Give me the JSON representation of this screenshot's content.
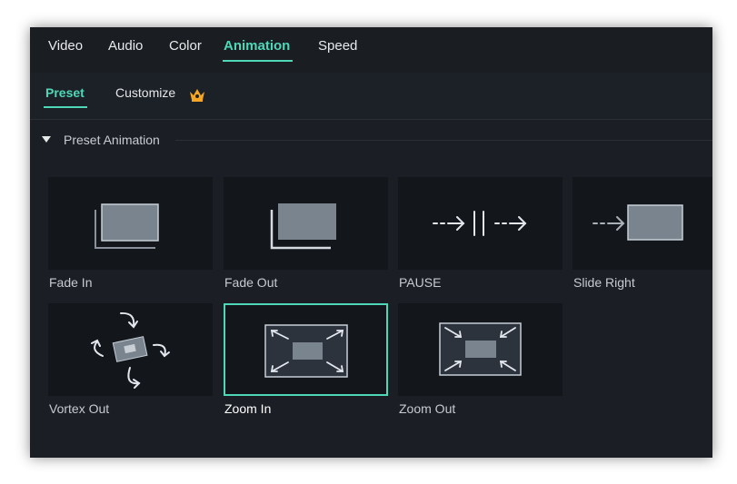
{
  "tabs": [
    {
      "label": "Video",
      "active": false
    },
    {
      "label": "Audio",
      "active": false
    },
    {
      "label": "Color",
      "active": false
    },
    {
      "label": "Animation",
      "active": true
    },
    {
      "label": "Speed",
      "active": false
    }
  ],
  "subtabs": [
    {
      "label": "Preset",
      "active": true
    },
    {
      "label": "Customize",
      "active": false,
      "icon": "crown-icon"
    }
  ],
  "section": {
    "label": "Preset Animation",
    "expanded": true,
    "icon": "caret-down-icon"
  },
  "presets": [
    {
      "label": "Fade In",
      "icon": "fade-in-icon",
      "selected": false
    },
    {
      "label": "Fade Out",
      "icon": "fade-out-icon",
      "selected": false
    },
    {
      "label": "PAUSE",
      "icon": "pause-icon",
      "selected": false
    },
    {
      "label": "Slide Right",
      "icon": "slide-right-icon",
      "selected": false
    },
    {
      "label": "Vortex Out",
      "icon": "vortex-out-icon",
      "selected": false
    },
    {
      "label": "Zoom In",
      "icon": "zoom-in-icon",
      "selected": true
    },
    {
      "label": "Zoom Out",
      "icon": "zoom-out-icon",
      "selected": false
    }
  ],
  "colors": {
    "accent": "#4fd8b8",
    "panel": "#1b1f25",
    "thumb_bg": "#13171c",
    "crown": "#f5a623"
  }
}
